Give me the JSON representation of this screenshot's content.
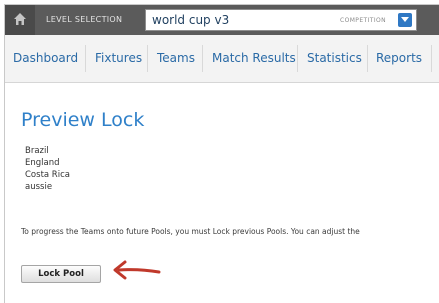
{
  "topbar": {
    "level_label": "LEVEL SELECTION",
    "level_value": "world cup v3",
    "competition_label": "COMPETITION"
  },
  "nav": {
    "items": [
      "Dashboard",
      "Fixtures",
      "Teams",
      "Match Results",
      "Statistics",
      "Reports"
    ]
  },
  "main": {
    "title": "Preview Lock",
    "teams": [
      "Brazil",
      "England",
      "Costa Rica",
      "aussie"
    ],
    "info": "To progress the Teams onto future Pools, you must Lock previous Pools. You can adjust the",
    "lock_button": "Lock Pool"
  },
  "colors": {
    "topbar": "#5b5b5b",
    "nav_link": "#2a6aa6",
    "title": "#2f80c9",
    "arrow": "#c0392b",
    "dropdown": "#2f78c4"
  },
  "icons": {
    "home": "home-icon",
    "dropdown": "chevron-down-icon",
    "annotation": "arrow-left-icon"
  }
}
